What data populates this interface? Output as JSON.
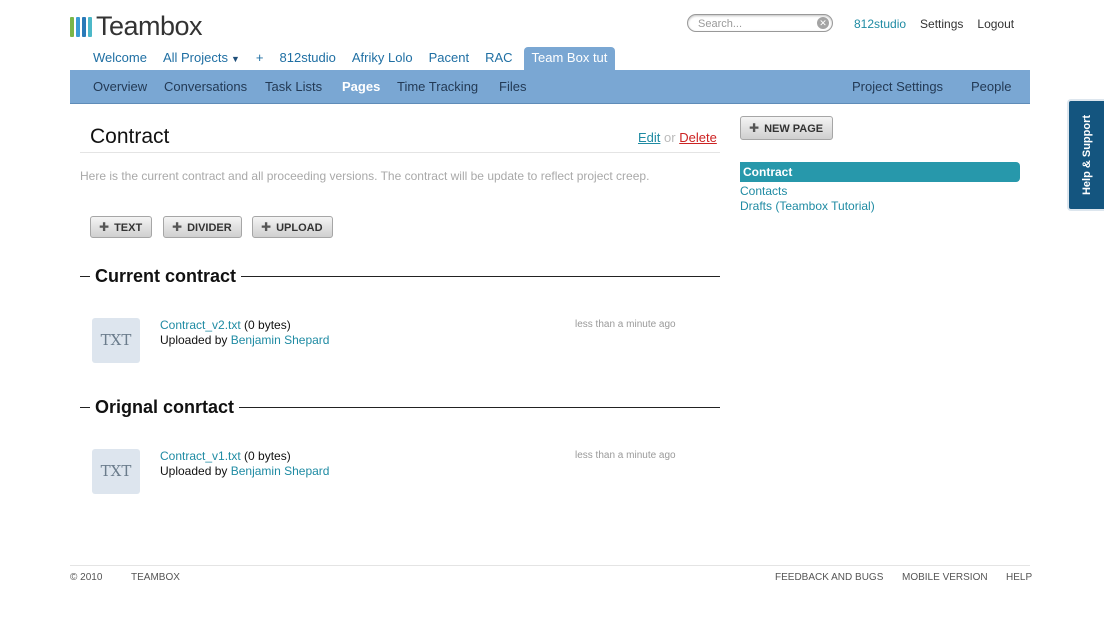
{
  "brand": {
    "name": "Teambox",
    "logo_colors": [
      "#7ab648",
      "#3a9bd5",
      "#2a7ab8",
      "#4cb8c8"
    ]
  },
  "search": {
    "placeholder": "Search..."
  },
  "top_links": [
    "812studio",
    "Settings",
    "Logout"
  ],
  "project_tabs": [
    {
      "label": "Welcome"
    },
    {
      "label": "All Projects",
      "dropdown": true
    },
    {
      "label": "+"
    },
    {
      "label": "812studio"
    },
    {
      "label": "Afriky Lolo"
    },
    {
      "label": "Pacent"
    },
    {
      "label": "RAC"
    },
    {
      "label": "Team Box tut",
      "active": true
    }
  ],
  "subnav": {
    "left": [
      "Overview",
      "Conversations",
      "Task Lists",
      "Pages",
      "Time Tracking",
      "Files"
    ],
    "right": [
      "Project Settings",
      "People"
    ],
    "active": "Pages"
  },
  "page": {
    "title": "Contract",
    "edit_label": "Edit",
    "or_label": "or",
    "delete_label": "Delete",
    "description": "Here is the current contract and all proceeding versions. The contract will be update to reflect project creep.",
    "buttons": [
      "TEXT",
      "DIVIDER",
      "UPLOAD"
    ]
  },
  "sections": [
    {
      "title": "Current contract",
      "file": {
        "thumb": "TXT",
        "name": "Contract_v2.txt",
        "size": "(0 bytes)",
        "uploaded_by_label": "Uploaded by",
        "uploader": "Benjamin Shepard",
        "time": "less than a minute ago"
      }
    },
    {
      "title": "Orignal conrtact",
      "file": {
        "thumb": "TXT",
        "name": "Contract_v1.txt",
        "size": "(0 bytes)",
        "uploaded_by_label": "Uploaded by",
        "uploader": "Benjamin Shepard",
        "time": "less than a minute ago"
      }
    }
  ],
  "sidebar": {
    "new_page_label": "NEW PAGE",
    "pages": [
      {
        "label": "Contract",
        "active": true
      },
      {
        "label": "Contacts"
      },
      {
        "label": "Drafts (Teambox Tutorial)"
      }
    ]
  },
  "footer": {
    "copyright": "© 2010",
    "brand": "TEAMBOX",
    "links": [
      "FEEDBACK AND BUGS",
      "MOBILE VERSION",
      "HELP"
    ]
  },
  "help_tab": "Help & Support",
  "colors": {
    "nav_bar": "#7aa7d3",
    "link": "#1f8ba3",
    "active_page": "#2798ab",
    "delete": "#cc2222",
    "help_tab": "#14557f"
  }
}
